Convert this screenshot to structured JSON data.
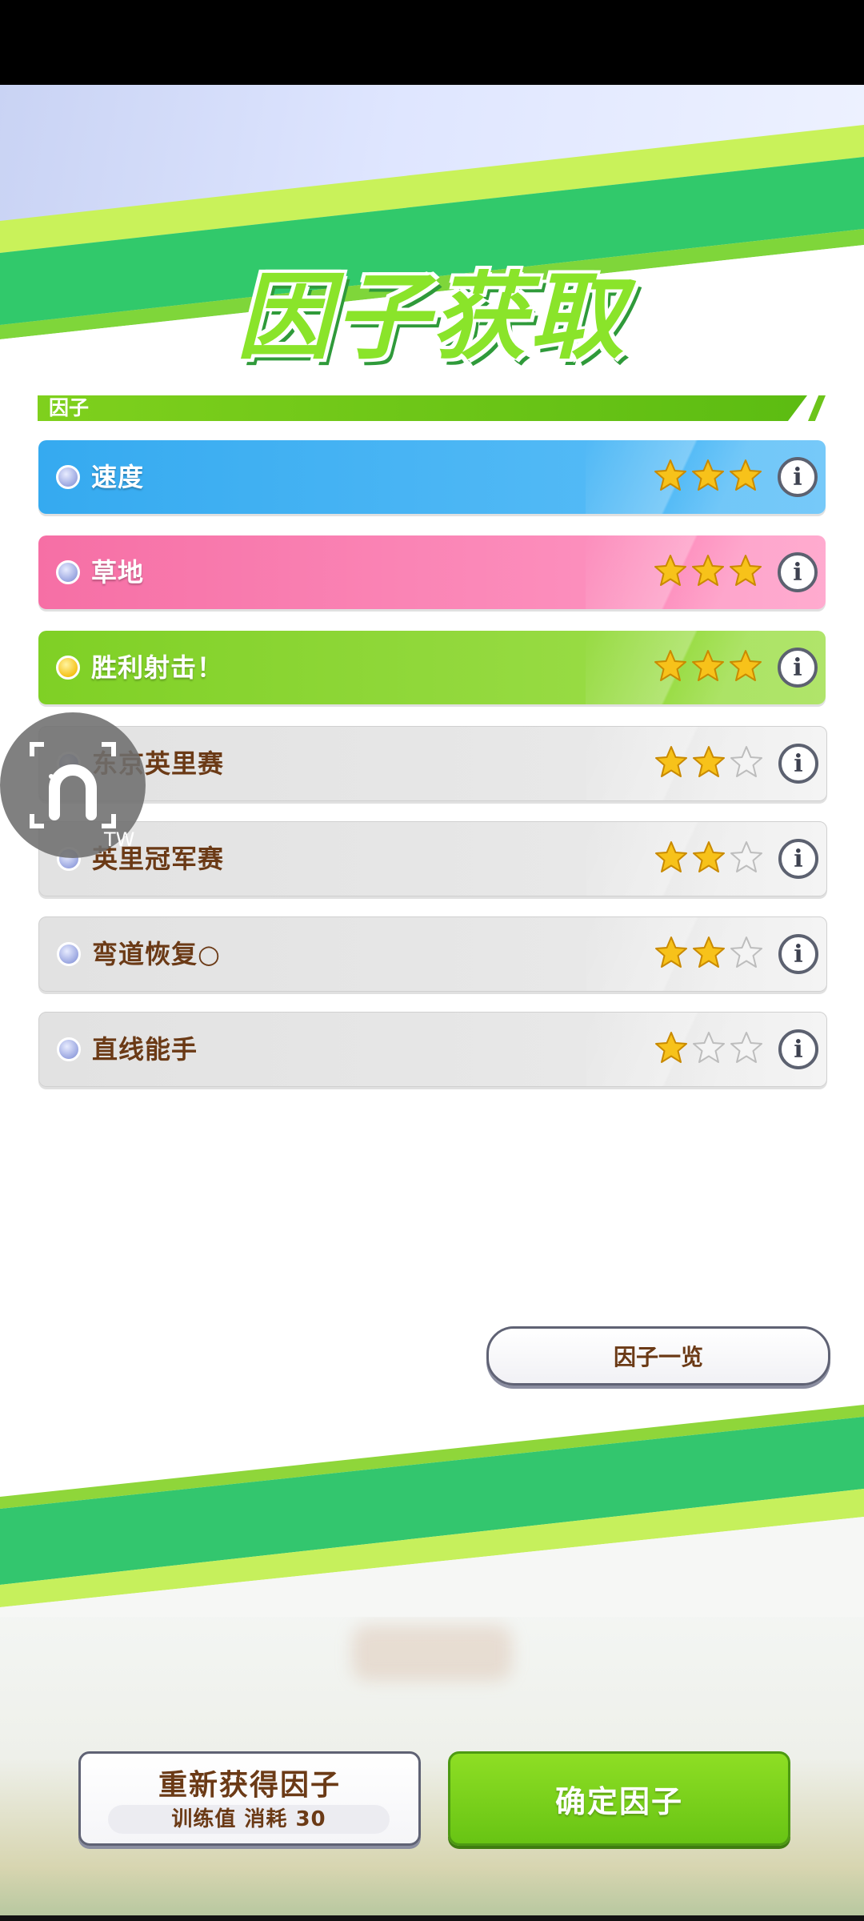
{
  "page": {
    "title": "因子获取",
    "section_label": "因子"
  },
  "factors": [
    {
      "name": "速度",
      "stars": 3,
      "style": "blue",
      "dot": "silver"
    },
    {
      "name": "草地",
      "stars": 3,
      "style": "pink",
      "dot": "silver"
    },
    {
      "name": "胜利射击！",
      "stars": 3,
      "style": "green",
      "dot": "gold"
    },
    {
      "name": "东京英里赛",
      "stars": 2,
      "style": "gray",
      "dot": "silver"
    },
    {
      "name": "英里冠军赛",
      "stars": 2,
      "style": "gray",
      "dot": "silver"
    },
    {
      "name": "弯道恢复○",
      "stars": 2,
      "style": "gray",
      "dot": "silver"
    },
    {
      "name": "直线能手",
      "stars": 1,
      "style": "gray",
      "dot": "silver"
    }
  ],
  "max_stars": 3,
  "overlay": {
    "badge": "TW",
    "icon": "horseshoe-icon"
  },
  "buttons": {
    "factor_list": "因子一览",
    "reacquire": "重新获得因子",
    "reacquire_cost": "训练值 消耗 30",
    "confirm": "确定因子"
  },
  "colors": {
    "blue": "#35aaf0",
    "pink": "#f66fa5",
    "green": "#7fd025",
    "gray": "#e2e2e2",
    "star_filled": "#f7c21a",
    "brown_text": "#6b3a16"
  }
}
